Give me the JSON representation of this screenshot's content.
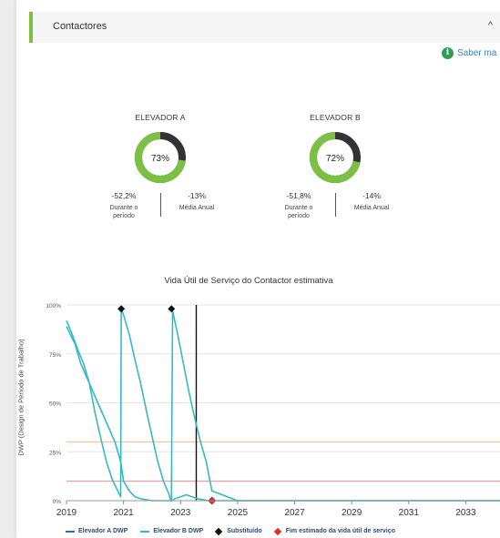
{
  "header": {
    "title": "Contactores",
    "chevron": "^"
  },
  "info": {
    "icon": "info-icon",
    "label": "Saber ma"
  },
  "gauges": [
    {
      "title": "ELEVADOR A",
      "percent": 73,
      "percent_label": "73%",
      "left_value": "-52,2%",
      "left_label_1": "Durante o",
      "left_label_2": "período",
      "right_value": "-13%",
      "right_label": "Média Anual"
    },
    {
      "title": "ELEVADOR B",
      "percent": 72,
      "percent_label": "72%",
      "left_value": "-51,8%",
      "left_label_1": "Durante o",
      "left_label_2": "período",
      "right_value": "-14%",
      "right_label": "Média Anual"
    }
  ],
  "colors": {
    "accent_green": "#7ac143",
    "gauge_dark": "#333333",
    "series": "#36b9c4",
    "orange_line": "#f5c58a",
    "red_line": "#f29a9a",
    "diamond_black": "#111111",
    "diamond_red": "#d9302b"
  },
  "chart_data": {
    "type": "line",
    "title": "Vida Útil de Serviço do Contactor estimativa",
    "ylabel": "DWP (Design de Período de Trabalho)",
    "xlabel": "",
    "xlim": [
      2019,
      2034.2
    ],
    "ylim": [
      0,
      100
    ],
    "x_ticks": [
      "2019",
      "2021",
      "2023",
      "2025",
      "2027",
      "2029",
      "2031",
      "2033"
    ],
    "y_ticks": [
      "0%",
      "25%",
      "50%",
      "75%",
      "100%"
    ],
    "grid": true,
    "legend_position": "bottom",
    "series": [
      {
        "name": "Elevador A DWP",
        "x": [
          2019,
          2019.2,
          2019.4,
          2019.6,
          2019.8,
          2020.0,
          2020.2,
          2020.4,
          2020.6,
          2020.8,
          2020.9,
          2020.92,
          2021.0,
          2021.2,
          2021.4,
          2021.6,
          2021.8,
          2022.0,
          2022.2,
          2022.4,
          2022.6,
          2022.66,
          2022.7,
          2022.8,
          2023.0,
          2023.2,
          2023.4,
          2023.6,
          2023.8,
          2023.95,
          2024.1,
          2025,
          2027,
          2029,
          2031,
          2033,
          2034.2
        ],
        "y": [
          92,
          85,
          77,
          70,
          60,
          45,
          32,
          20,
          11,
          5,
          2,
          98,
          95,
          85,
          72,
          60,
          46,
          33,
          20,
          10,
          3,
          0,
          0,
          1,
          2,
          3,
          2,
          1,
          0.5,
          0,
          0,
          0,
          0,
          0,
          0,
          0,
          0
        ]
      },
      {
        "name": "Elevador B DWP",
        "x": [
          2019,
          2019.3,
          2019.5,
          2019.8,
          2020.1,
          2020.4,
          2020.7,
          2020.9,
          2021.0,
          2021.2,
          2021.4,
          2021.6,
          2021.8,
          2022.0,
          2022.2,
          2022.4,
          2022.6,
          2022.68,
          2022.72,
          2022.9,
          2023.1,
          2023.3,
          2023.5,
          2023.7,
          2023.9,
          2024.1,
          2025,
          2027,
          2029,
          2031,
          2033,
          2034.2
        ],
        "y": [
          89,
          80,
          70,
          60,
          50,
          40,
          30,
          20,
          10,
          5,
          2,
          1,
          0.5,
          0,
          0,
          0,
          0,
          0,
          97,
          85,
          70,
          55,
          42,
          30,
          20,
          5,
          0,
          0,
          0,
          0,
          0,
          0
        ]
      }
    ],
    "markers": {
      "replaced_label": "Substituído",
      "replaced": [
        {
          "x": 2020.92,
          "y": 98
        },
        {
          "x": 2022.68,
          "y": 98
        }
      ],
      "end_of_life_label": "Fim estimado da vida útil de serviço",
      "end_of_life": [
        {
          "x": 2024.1,
          "y": 0
        }
      ]
    },
    "reference_lines": [
      {
        "y": 30,
        "color": "#f5c58a"
      },
      {
        "y": 10,
        "color": "#f29a9a"
      }
    ],
    "vertical_line": {
      "x": 2023.55
    }
  },
  "legend": {
    "a_label": "Elevador A DWP",
    "b_label": "Elevador B DWP",
    "replaced_label": "Substituído",
    "eol_label": "Fim estimado da vida útil de serviço"
  }
}
